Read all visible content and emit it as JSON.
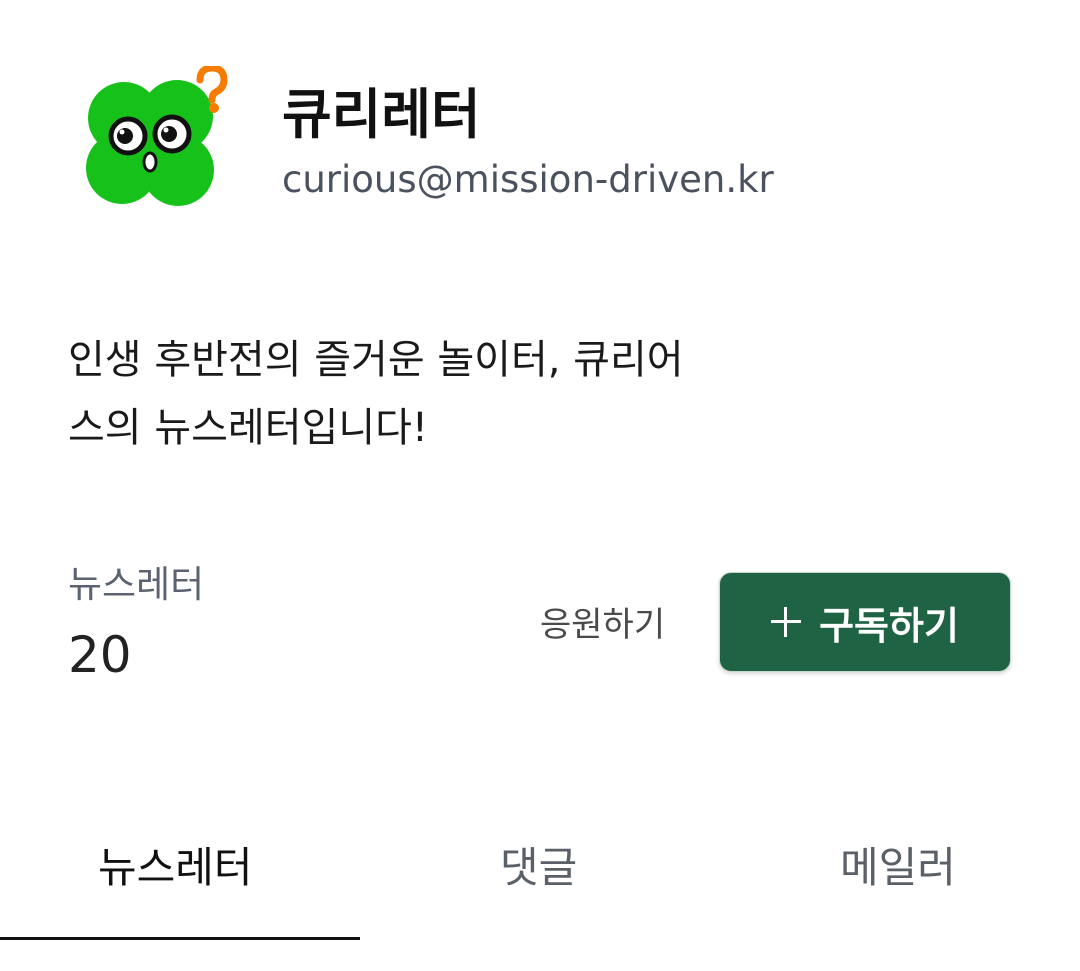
{
  "profile": {
    "name": "큐리레터",
    "email": "curious@mission-driven.kr"
  },
  "description": {
    "line1": "인생 후반전의 즐거운 놀이터, 큐리어",
    "line2": "스의 뉴스레터입니다!"
  },
  "stats": {
    "label": "뉴스레터",
    "value": "20"
  },
  "actions": {
    "support_label": "응원하기",
    "subscribe_label": "구독하기"
  },
  "tabs": [
    {
      "label": "뉴스레터",
      "active": true
    },
    {
      "label": "댓글",
      "active": false
    },
    {
      "label": "메일러",
      "active": false
    }
  ],
  "colors": {
    "brand_green": "#1e6344",
    "avatar_green": "#16c21a",
    "question_orange": "#f57c00"
  }
}
